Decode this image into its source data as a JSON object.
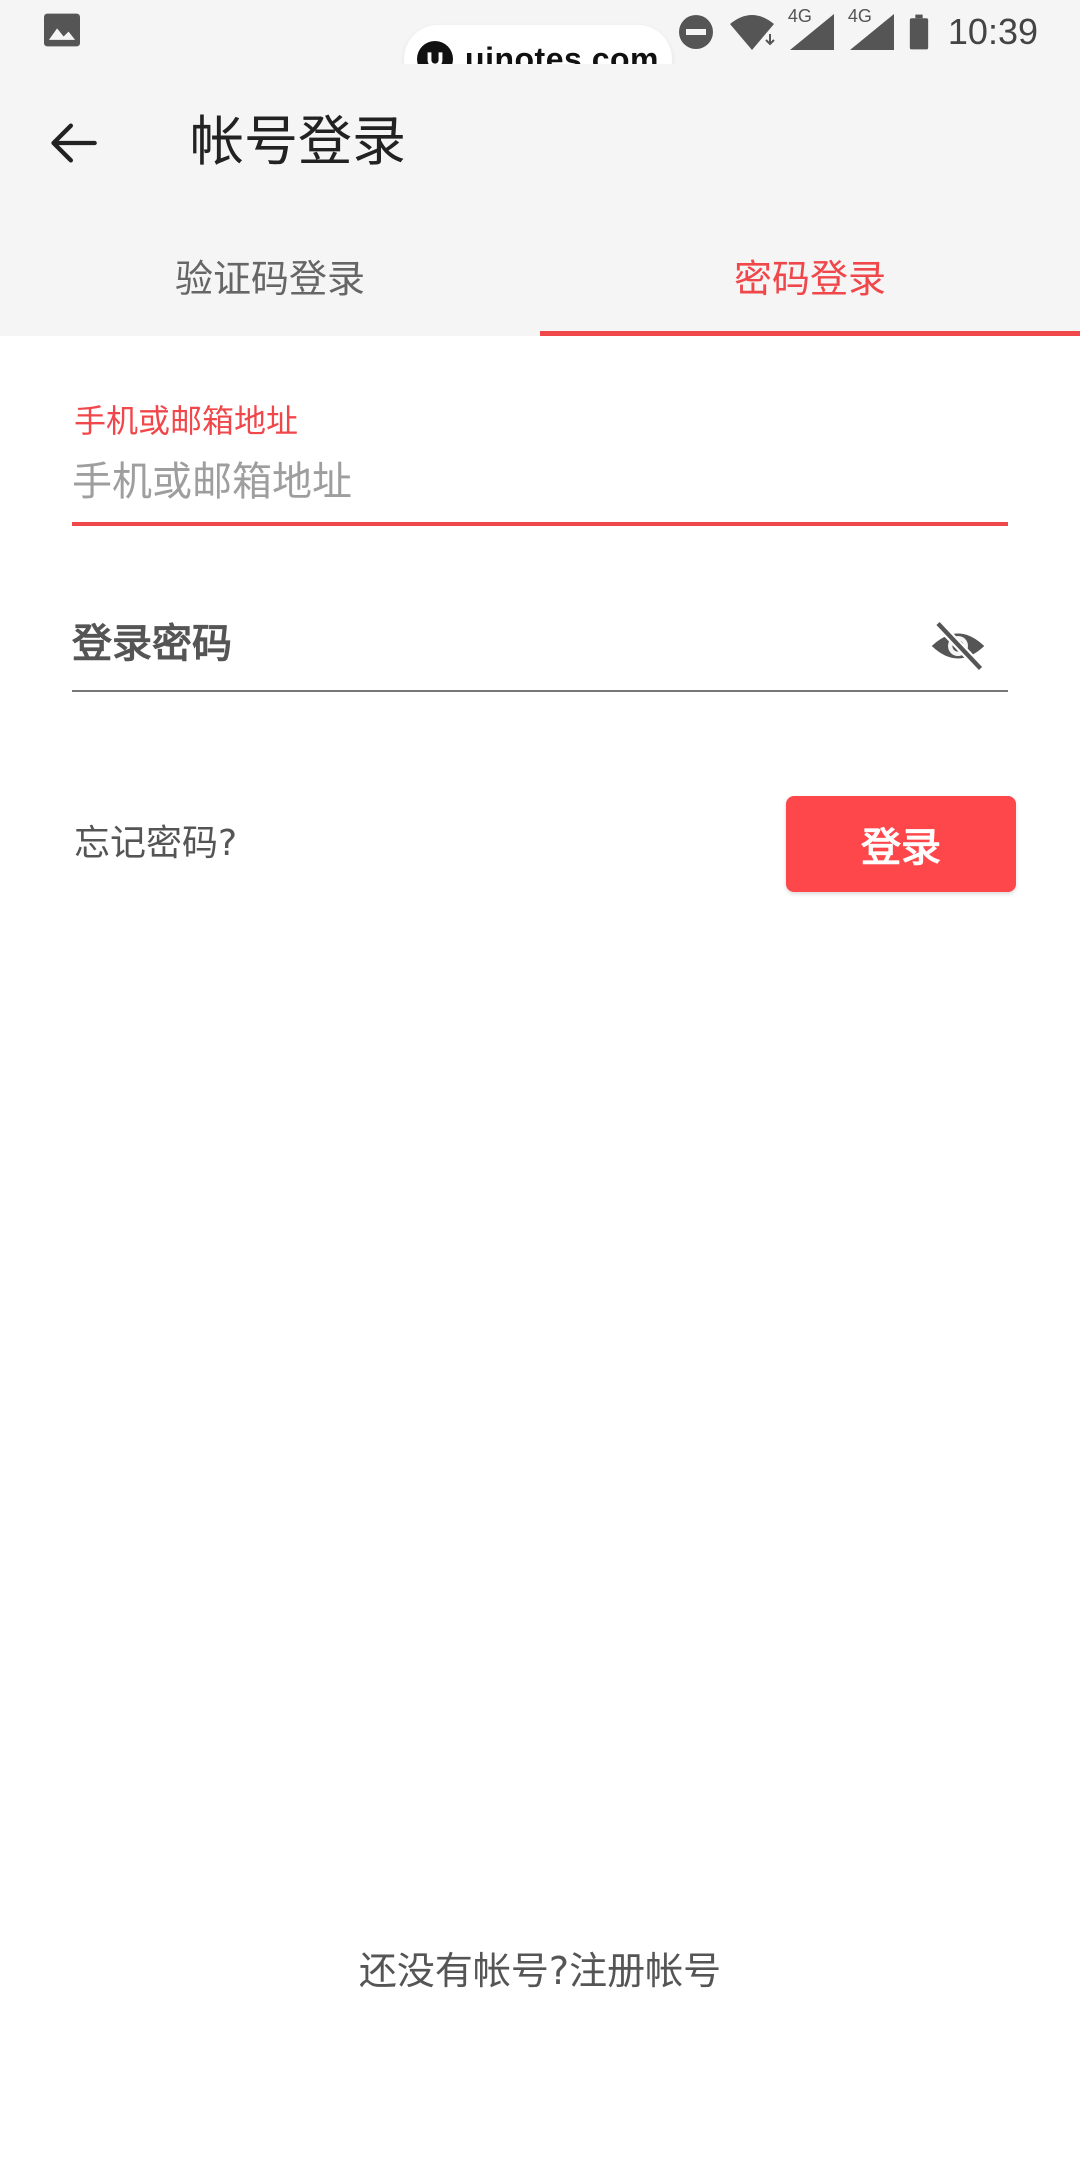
{
  "status_bar": {
    "time": "10:39",
    "network_1": "4G",
    "network_2": "4G",
    "icons": [
      "image-icon",
      "dnd-icon",
      "wifi-icon",
      "signal-icon",
      "signal-icon",
      "battery-icon"
    ]
  },
  "watermark": {
    "text": "uinotes.com"
  },
  "app_bar": {
    "title": "帐号登录",
    "back_icon": "arrow-left-icon"
  },
  "tabs": [
    {
      "label": "验证码登录",
      "active": false
    },
    {
      "label": "密码登录",
      "active": true
    }
  ],
  "form": {
    "username_label": "手机或邮箱地址",
    "username_placeholder": "手机或邮箱地址",
    "password_placeholder": "登录密码",
    "visibility_icon": "eye-off-icon",
    "forgot": "忘记密码?",
    "login": "登录"
  },
  "footer": {
    "prompt": "还没有帐号?",
    "register": "注册帐号"
  },
  "colors": {
    "accent": "#f0474b",
    "button": "#fd474b",
    "appbar_bg": "#f5f5f5"
  }
}
